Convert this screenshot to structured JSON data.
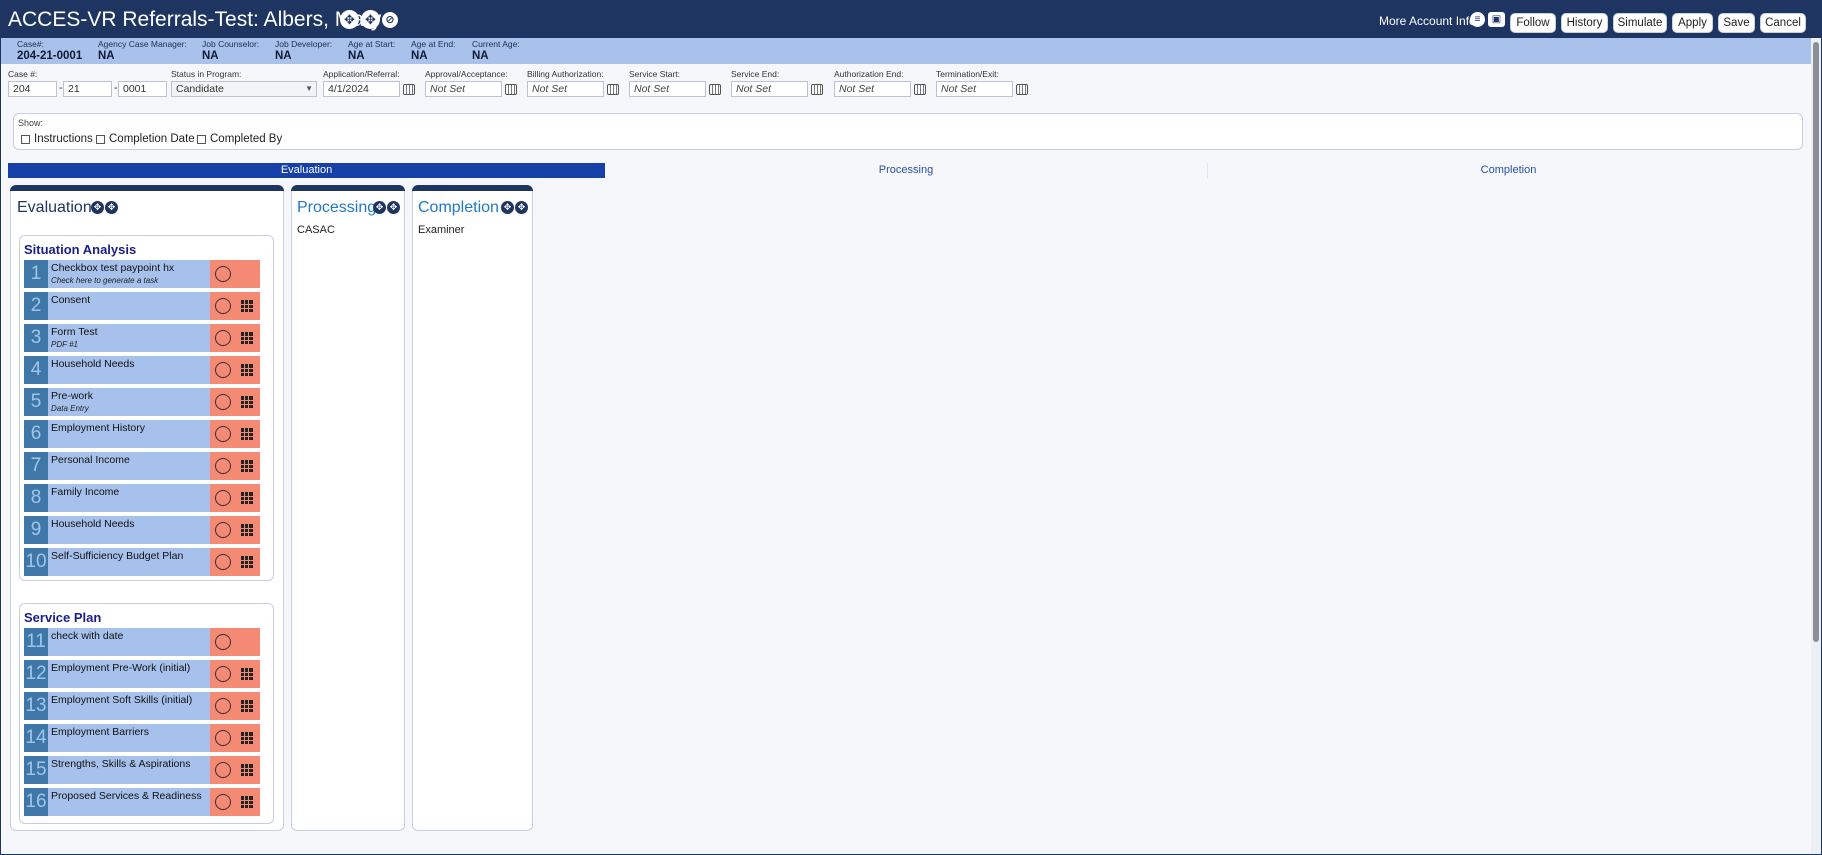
{
  "header": {
    "title": "ACCES-VR Referrals-Test: Albers, Mary",
    "more_info": "More Account Info",
    "buttons": [
      "Follow",
      "History",
      "Simulate",
      "Apply",
      "Save",
      "Cancel"
    ]
  },
  "info": [
    {
      "label": "Case#:",
      "value": "204-21-0001"
    },
    {
      "label": "Agency Case Manager:",
      "value": "NA"
    },
    {
      "label": "Job Counselor:",
      "value": "NA"
    },
    {
      "label": "Job Developer:",
      "value": "NA"
    },
    {
      "label": "Age at Start:",
      "value": "NA"
    },
    {
      "label": "Age at End:",
      "value": "NA"
    },
    {
      "label": "Current Age:",
      "value": "NA"
    }
  ],
  "fields": {
    "case_label": "Case #:",
    "case_parts": [
      "204",
      "21",
      "0001"
    ],
    "status_label": "Status in Program:",
    "status_value": "Candidate",
    "dates": [
      {
        "label": "Application/Referral:",
        "value": "4/1/2024"
      },
      {
        "label": "Approval/Acceptance:",
        "value": "Not Set"
      },
      {
        "label": "Billing Authorization:",
        "value": "Not Set"
      },
      {
        "label": "Service Start:",
        "value": "Not Set"
      },
      {
        "label": "Service End:",
        "value": "Not Set"
      },
      {
        "label": "Authorization End:",
        "value": "Not Set"
      },
      {
        "label": "Termination/Exit:",
        "value": "Not Set"
      }
    ]
  },
  "show": {
    "label": "Show:",
    "options": [
      "Instructions",
      "Completion Date",
      "Completed By"
    ]
  },
  "phases": [
    "Evaluation",
    "Processing",
    "Completion"
  ],
  "panels": {
    "evaluation": {
      "title": "Evaluation",
      "groups": [
        {
          "title": "Situation Analysis",
          "tasks": [
            {
              "num": "1",
              "name": "Checkbox test paypoint hx",
              "sub": "Check here to generate a task",
              "grid": false
            },
            {
              "num": "2",
              "name": "Consent",
              "sub": "",
              "grid": true
            },
            {
              "num": "3",
              "name": "Form Test",
              "sub": "PDF #1",
              "grid": true
            },
            {
              "num": "4",
              "name": "Household Needs",
              "sub": "",
              "grid": true
            },
            {
              "num": "5",
              "name": "Pre-work",
              "sub": "Data Entry",
              "grid": true
            },
            {
              "num": "6",
              "name": "Employment History",
              "sub": "",
              "grid": true
            },
            {
              "num": "7",
              "name": "Personal Income",
              "sub": "",
              "grid": true
            },
            {
              "num": "8",
              "name": "Family Income",
              "sub": "",
              "grid": true
            },
            {
              "num": "9",
              "name": "Household Needs",
              "sub": "",
              "grid": true
            },
            {
              "num": "10",
              "name": "Self-Sufficiency Budget Plan",
              "sub": "",
              "grid": true
            }
          ]
        },
        {
          "title": "Service Plan",
          "tasks": [
            {
              "num": "11",
              "name": "check with date",
              "sub": "",
              "grid": false
            },
            {
              "num": "12",
              "name": "Employment Pre-Work (initial)",
              "sub": "",
              "grid": true
            },
            {
              "num": "13",
              "name": "Employment Soft Skills (initial)",
              "sub": "",
              "grid": true
            },
            {
              "num": "14",
              "name": "Employment Barriers",
              "sub": "",
              "grid": true
            },
            {
              "num": "15",
              "name": "Strengths, Skills & Aspirations",
              "sub": "",
              "grid": true
            },
            {
              "num": "16",
              "name": "Proposed Services & Readiness",
              "sub": "",
              "grid": true
            }
          ]
        }
      ]
    },
    "processing": {
      "title": "Processing",
      "sub": "CASAC"
    },
    "completion": {
      "title": "Completion",
      "sub": "Examiner"
    }
  },
  "colors": {
    "header_bg": "#1f3561",
    "info_bg": "#a8c2ec",
    "active_tab": "#1540a8",
    "task_bg": "#a6c1ec",
    "task_num_bg": "#3f77a8",
    "task_status_bg": "#f48a74"
  },
  "icons": {
    "title_icons": [
      "expand-icon",
      "link-icon"
    ],
    "more_info_icons": [
      "chat-icon",
      "contact-card-icon"
    ],
    "task_icons": [
      "status-circle-icon",
      "grid-icon"
    ],
    "field_icons": [
      "calendar-icon",
      "dropdown-arrow-icon"
    ]
  }
}
